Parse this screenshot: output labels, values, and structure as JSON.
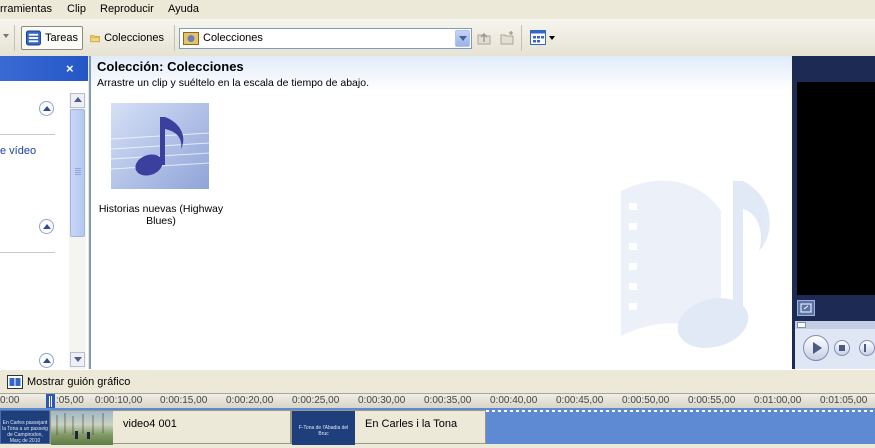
{
  "menu": {
    "items": [
      "rramientas",
      "Clip",
      "Reproducir",
      "Ayuda"
    ]
  },
  "toolbar": {
    "tasks_label": "Tareas",
    "collections_label": "Colecciones",
    "collection_dropdown_value": "Colecciones"
  },
  "collection": {
    "title": "Colección: Colecciones",
    "subtitle": "Arrastre un clip y suéltelo en la escala de tiempo de abajo.",
    "items": [
      {
        "caption": "Historias nuevas (Highway Blues)"
      }
    ]
  },
  "task_pane": {
    "partial_link": "e vídeo"
  },
  "storyboard": {
    "toggle_label": "Mostrar guión gráfico"
  },
  "timeline": {
    "ticks": [
      "0:00",
      ":05,00",
      "0:00:10,00",
      "0:00:15,00",
      "0:00:20,00",
      "0:00:25,00",
      "0:00:30,00",
      "0:00:35,00",
      "0:00:40,00",
      "0:00:45,00",
      "0:00:50,00",
      "0:00:55,00",
      "0:01:00,00",
      "0:01:05,00"
    ],
    "clips": [
      {
        "label": "",
        "thumb_text": "En Carles passejant la Tona a un passeig de Campirodon, Març de 2010"
      },
      {
        "label": "video4 001"
      },
      {
        "label": "En Carles i la Tona",
        "thumb_text": "F-Tona de l'Abadia del Bruc"
      }
    ]
  },
  "colors": {
    "accent_blue": "#2457c6",
    "track_blue": "#5e8ad4",
    "clip_bg": "#ece9d8"
  }
}
